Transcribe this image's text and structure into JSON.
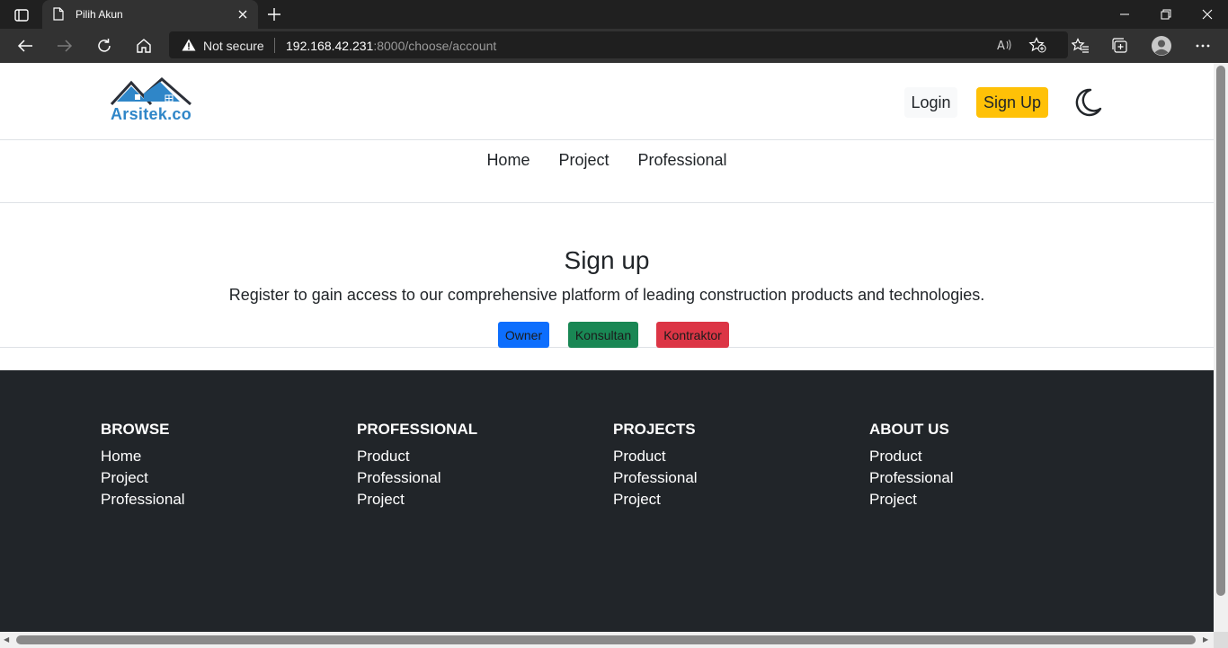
{
  "browser": {
    "tab_title": "Pilih Akun",
    "security_label": "Not secure",
    "url_host": "192.168.42.231",
    "url_rest": ":8000/choose/account"
  },
  "header": {
    "logo_text": "Arsitek.co",
    "login_label": "Login",
    "signup_label": "Sign Up"
  },
  "nav": {
    "items": [
      "Home",
      "Project",
      "Professional"
    ]
  },
  "hero": {
    "title": "Sign up",
    "subtitle": "Register to gain access to our comprehensive platform of leading construction products and technologies.",
    "roles": [
      {
        "label": "Owner",
        "color": "#0d6efd"
      },
      {
        "label": "Konsultan",
        "color": "#198754"
      },
      {
        "label": "Kontraktor",
        "color": "#dc3545"
      }
    ]
  },
  "footer": {
    "columns": [
      {
        "heading": "BROWSE",
        "links": [
          "Home",
          "Project",
          "Professional"
        ]
      },
      {
        "heading": "PROFESSIONAL",
        "links": [
          "Product",
          "Professional",
          "Project"
        ]
      },
      {
        "heading": "PROJECTS",
        "links": [
          "Product",
          "Professional",
          "Project"
        ]
      },
      {
        "heading": "ABOUT US",
        "links": [
          "Product",
          "Professional",
          "Project"
        ]
      }
    ]
  },
  "colors": {
    "accent_signup": "#ffc107",
    "footer_bg": "#212529",
    "logo_blue": "#2f86c8"
  }
}
